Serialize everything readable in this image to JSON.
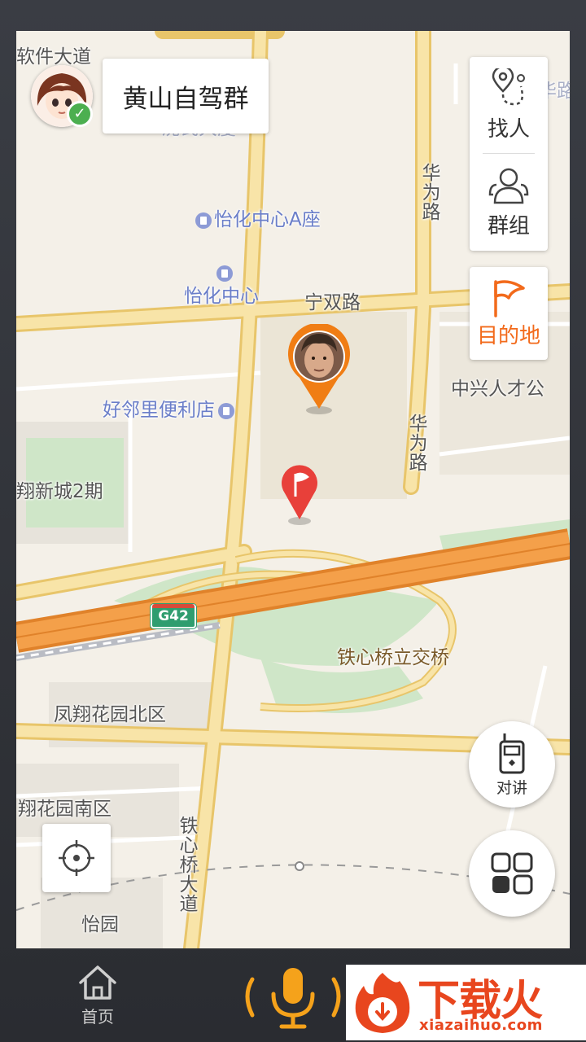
{
  "group": {
    "name": "黄山自驾群"
  },
  "side_panel": {
    "find_people_label": "找人",
    "groups_label": "群组",
    "destination_label": "目的地"
  },
  "round_buttons": {
    "walkie_talkie_label": "对讲"
  },
  "map": {
    "labels": {
      "software_ave": "软件大道",
      "shenshi": "沈氏大厦",
      "yihua_a": "怡化中心A座",
      "yihua": "怡化中心",
      "ningshuang": "宁双路",
      "huawei_road_1": "华为路",
      "huawei_road_2": "华为路",
      "xinhua": "新华路",
      "zte": "中兴人才公",
      "haolinli": "好邻里便利店",
      "fengxiang2": "翔新城2期",
      "highway": "G42",
      "tiexin_interchange": "铁心桥立交桥",
      "fengxiang_north": "凤翔花园北区",
      "fengxiang_south": "翔花园南区",
      "tiexinqiao_ave": "铁心桥大道",
      "yiyuan": "怡园"
    }
  },
  "bottom_bar": {
    "home_label": "首页",
    "mic_label": ""
  },
  "watermark": {
    "brand": "下载火",
    "url": "xiazaihuo.com"
  },
  "colors": {
    "accent": "#f26a1b",
    "marker_red": "#e8403a",
    "road_yellow": "#f6d98a",
    "highway_orange": "#f4a04a",
    "map_bg": "#f4f0e8",
    "green": "#cfe6c8"
  }
}
